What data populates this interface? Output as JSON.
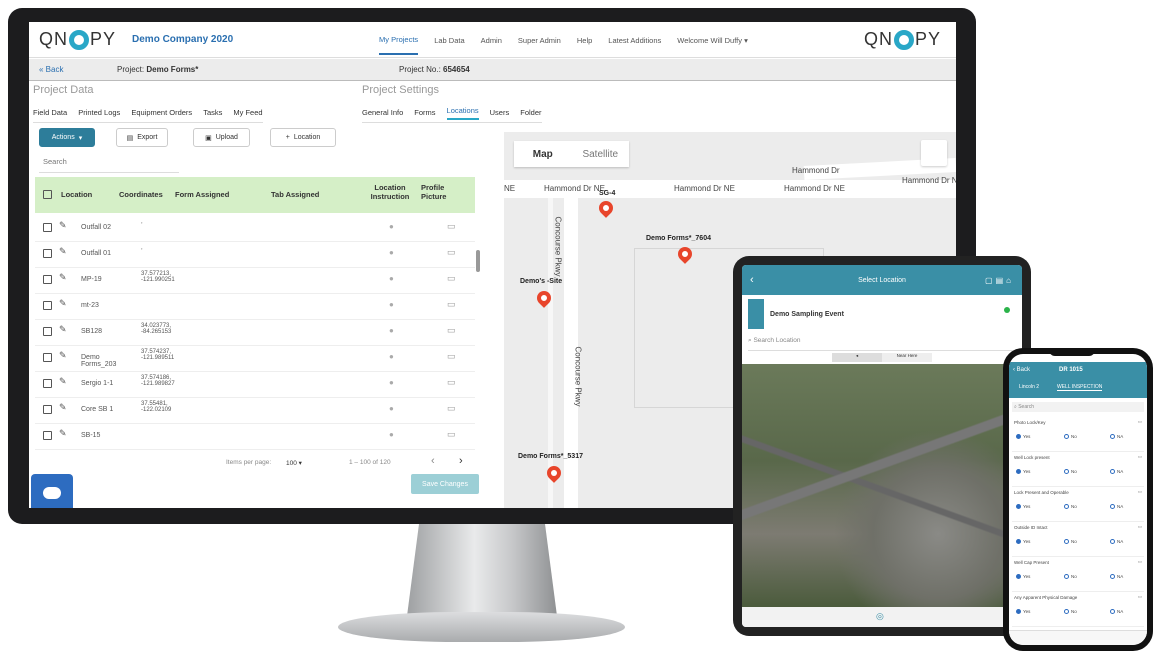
{
  "brand": {
    "logo_text": "QNOPY",
    "company": "Demo Company 2020"
  },
  "nav": {
    "items": [
      "My Projects",
      "Lab Data",
      "Admin",
      "Super Admin",
      "Help",
      "Latest Additions"
    ],
    "active": "My Projects",
    "welcome": "Welcome Will Duffy"
  },
  "subbar": {
    "back": "Back",
    "project_label": "Project:",
    "project_name": "Demo Forms*",
    "project_no_label": "Project No.:",
    "project_no": "654654"
  },
  "project_data": {
    "title": "Project Data",
    "tabs": [
      "Field Data",
      "Printed Logs",
      "Equipment Orders",
      "Tasks",
      "My Feed"
    ]
  },
  "project_settings": {
    "title": "Project Settings",
    "tabs": [
      "General Info",
      "Forms",
      "Locations",
      "Users",
      "Folder"
    ],
    "active": "Locations"
  },
  "toolbar": {
    "actions": "Actions",
    "export": "Export",
    "upload": "Upload",
    "location": "Location"
  },
  "search": {
    "placeholder": "Search"
  },
  "table": {
    "headers": {
      "location": "Location",
      "coordinates": "Coordinates",
      "form": "Form Assigned",
      "tab": "Tab Assigned",
      "instruction": "Location Instruction",
      "picture": "Profile Picture"
    },
    "rows": [
      {
        "name": "Outfall 02",
        "coords": ","
      },
      {
        "name": "Outfall 01",
        "coords": ","
      },
      {
        "name": "MP-19",
        "coords": "37.577213, -121.990251"
      },
      {
        "name": "mt-23",
        "coords": ""
      },
      {
        "name": "SB128",
        "coords": "34.023773, -84.265153"
      },
      {
        "name": "Demo Forms_203",
        "coords": "37.574237, -121.989511"
      },
      {
        "name": "Sergio 1-1",
        "coords": "37.574186, -121.989827"
      },
      {
        "name": "Core SB 1",
        "coords": "37.55481, -122.02109"
      },
      {
        "name": "SB-15",
        "coords": ""
      }
    ]
  },
  "pagination": {
    "items_label": "Items per page:",
    "per_page": "100",
    "range": "1 – 100 of 120"
  },
  "save_changes": "Save Changes",
  "map": {
    "tab_map": "Map",
    "tab_satellite": "Satellite",
    "roads": [
      "Hammond Dr",
      "Hammond Dr NE",
      "Hammond Dr NE",
      "Hammond Dr NE",
      "Hammond Dr N",
      "Concourse Pkwy",
      "Concourse Pkwy",
      "NE"
    ],
    "pins": [
      "SG-4",
      "Demo Forms*_7604",
      "Demo's -Site",
      "Demo Forms*_5317"
    ]
  },
  "tablet": {
    "title": "Select Location",
    "event": "Demo Sampling Event",
    "search_placeholder": "Search Location",
    "toggle_a": "",
    "toggle_b": "Near Here"
  },
  "phone": {
    "back": "Back",
    "title": "DR 1015",
    "tab_a": "Lincoln 2",
    "tab_b": "WELL INSPECTION",
    "search": "Search",
    "questions": [
      "Photo Lock/Key",
      "Well Lock present",
      "Lock Present and Operable",
      "Outside ID Intact",
      "Well Cap Present",
      "Any Apparent Physical Damage"
    ],
    "options": [
      "Yes",
      "No",
      "NA"
    ]
  }
}
